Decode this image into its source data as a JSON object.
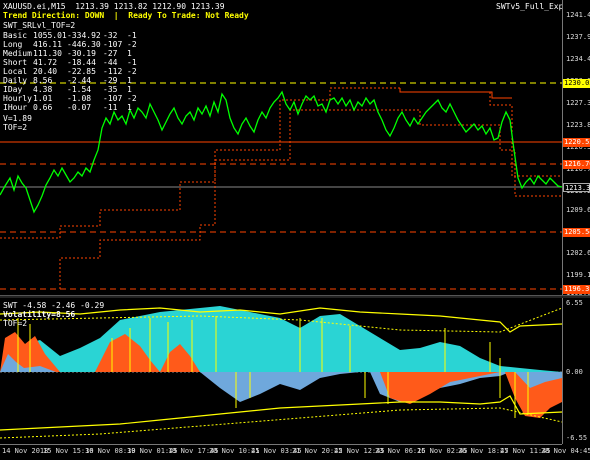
{
  "header": {
    "symbol_info": "XAUUSD.ei,M15  1213.39 1213.82 1212.90 1213.39",
    "trend_label": "Trend Direction:",
    "trend_value": "DOWN",
    "separator": "|",
    "ready_label": "Ready To Trade:",
    "ready_value": "Not Ready",
    "expert_name": "SWTv5_Full_Exp",
    "expert_icon": "smiley-icon"
  },
  "indicator_name": "SWT_SRLvl_TOF=2",
  "stats": [
    {
      "name": "Basic",
      "a": "1055.01",
      "b": "-334.92",
      "c": "-32",
      "d": "-1"
    },
    {
      "name": "Long",
      "a": "416.11",
      "b": "-446.30",
      "c": "-107",
      "d": "-2"
    },
    {
      "name": "Medium",
      "a": "111.30",
      "b": "-30.19",
      "c": "-27",
      "d": "1"
    },
    {
      "name": "Short",
      "a": "41.72",
      "b": "-18.44",
      "c": "-44",
      "d": "-1"
    },
    {
      "name": "Local",
      "a": "20.40",
      "b": "-22.85",
      "c": "-112",
      "d": "-2"
    },
    {
      "name": "Daily",
      "a": "8.56",
      "b": "-2.44",
      "c": "-29",
      "d": "1"
    },
    {
      "name": "IDay",
      "a": "4.38",
      "b": "-1.54",
      "c": "-35",
      "d": "1"
    },
    {
      "name": "Hourly",
      "a": "1.01",
      "b": "-1.08",
      "c": "-107",
      "d": "-2"
    },
    {
      "name": "IHour",
      "a": "0.66",
      "b": "-0.07",
      "c": "-11",
      "d": "1"
    }
  ],
  "v_line": "V=1.89",
  "tof_line": "TOF=2",
  "price_axis": {
    "ticks": [
      "1241.40",
      "1237.90",
      "1234.40",
      "1230.85",
      "1227.35",
      "1223.85",
      "1220.35",
      "1216.70",
      "1213.20",
      "1209.60",
      "1206.15",
      "1202.65",
      "1199.15",
      "1195.65"
    ],
    "tags": [
      {
        "label": "1230.05",
        "color": "#ffff00",
        "text_color": "#000000"
      },
      {
        "label": "1220.55",
        "color": "#ff4500",
        "text_color": "#ffffff"
      },
      {
        "label": "1216.70",
        "color": "#ff4500",
        "text_color": "#ffffff"
      },
      {
        "label": "1213.39",
        "color": "#000000",
        "text_color": "#ffffff"
      },
      {
        "label": "1205.54",
        "color": "#ff4500",
        "text_color": "#ffffff"
      },
      {
        "label": "1196.31",
        "color": "#ff4500",
        "text_color": "#ffffff"
      }
    ]
  },
  "indicator_panel": {
    "title": "SWT -4.58 -2.46 -0.29",
    "volatility": "Volatility=8.56",
    "tof": "TOF=2",
    "axis_top": "6.55",
    "axis_mid": "0.00",
    "axis_bottom": "-6.55"
  },
  "time_axis": [
    "14 Nov 2018",
    "15 Nov 15:30",
    "16 Nov 08:30",
    "19 Nov 01:45",
    "19 Nov 17:45",
    "20 Nov 10:45",
    "21 Nov 03:45",
    "21 Nov 20:45",
    "22 Nov 12:45",
    "23 Nov 06:15",
    "26 Nov 02:45",
    "26 Nov 18:45",
    "27 Nov 11:45",
    "28 Nov 04:45"
  ],
  "colors": {
    "price_line": "#00ff00",
    "resistance": "#ff4500",
    "support_yellow": "#ffff00",
    "cyan_fill": "#2ad4d4",
    "orange_fill": "#ff5a1a",
    "blue_fill": "#6fa8dc"
  }
}
